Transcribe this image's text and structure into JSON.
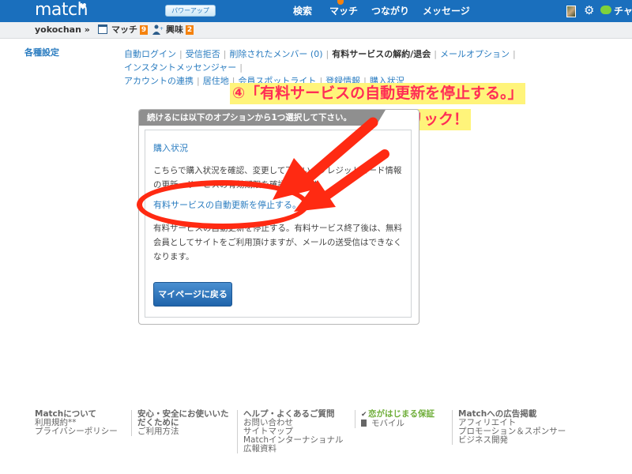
{
  "header": {
    "logo": "match",
    "powerup_button": "パワーアップ",
    "nav": [
      "検索",
      "マッチ",
      "つながり",
      "メッセージ"
    ],
    "chat_label": "チャ"
  },
  "subheader": {
    "username": "yokochan »",
    "match_label": "マッチ",
    "match_count": "9",
    "interest_label": "興味",
    "interest_count": "2"
  },
  "settings": {
    "title": "各種設定",
    "links": [
      {
        "label": "自動ログイン",
        "current": false
      },
      {
        "label": "受信拒否",
        "current": false
      },
      {
        "label": "削除されたメンバー (0)",
        "current": false
      },
      {
        "label": "有料サービスの解約/退会",
        "current": true
      },
      {
        "label": "メールオプション",
        "current": false
      },
      {
        "label": "インスタントメッセンジャー",
        "current": false
      },
      {
        "label": "アカウントの連携",
        "current": false
      },
      {
        "label": "居住地",
        "current": false
      },
      {
        "label": "会員スポットライト",
        "current": false
      },
      {
        "label": "登録情報",
        "current": false
      },
      {
        "label": "購入状況",
        "current": false
      }
    ]
  },
  "annotation": {
    "line1": "④「有料サービスの自動更新を停止する。」",
    "line2": "をクリック！"
  },
  "dialog": {
    "header": "続けるには以下のオプションから1つ選択して下さい。",
    "option1_link": "購入状況",
    "option1_desc": "こちらで購入状況を確認、変更して下さい。クレジットカード情報の更新、サービスの有効期限を確認できます。",
    "option2_link": "有料サービスの自動更新を停止する。",
    "option2_desc": "有料サービスの自動更新を停止する。有料サービス終了後は、無料会員としてサイトをご利用頂けますが、メールの送受信はできなくなります。",
    "back_button": "マイページに戻る"
  },
  "footer": {
    "columns": [
      {
        "heading": "Matchについて",
        "links": [
          "利用規約**",
          "プライバシーポリシー"
        ]
      },
      {
        "heading": "安心・安全にお使いいただくために",
        "links": [
          "ご利用方法"
        ]
      },
      {
        "heading": "ヘルプ・よくあるご質問",
        "links": [
          "お問い合わせ",
          "サイトマップ",
          "Matchインターナショナル",
          "広報資料"
        ]
      },
      {
        "heading": "恋がはじまる保証",
        "links": [
          "モバイル"
        ]
      },
      {
        "heading": "Matchへの広告掲載",
        "links": [
          "アフィリエイト",
          "プロモーション＆スポンサー",
          "ビジネス開発"
        ]
      }
    ]
  },
  "colors": {
    "brand_blue": "#1a6fbd",
    "link_blue": "#2a7cc0",
    "badge_orange": "#f5820e",
    "annotation_red": "#ff2d55",
    "annotation_bg": "#fff47a",
    "mark_red": "#ff2a12",
    "guarantee_green": "#6fae3a"
  }
}
